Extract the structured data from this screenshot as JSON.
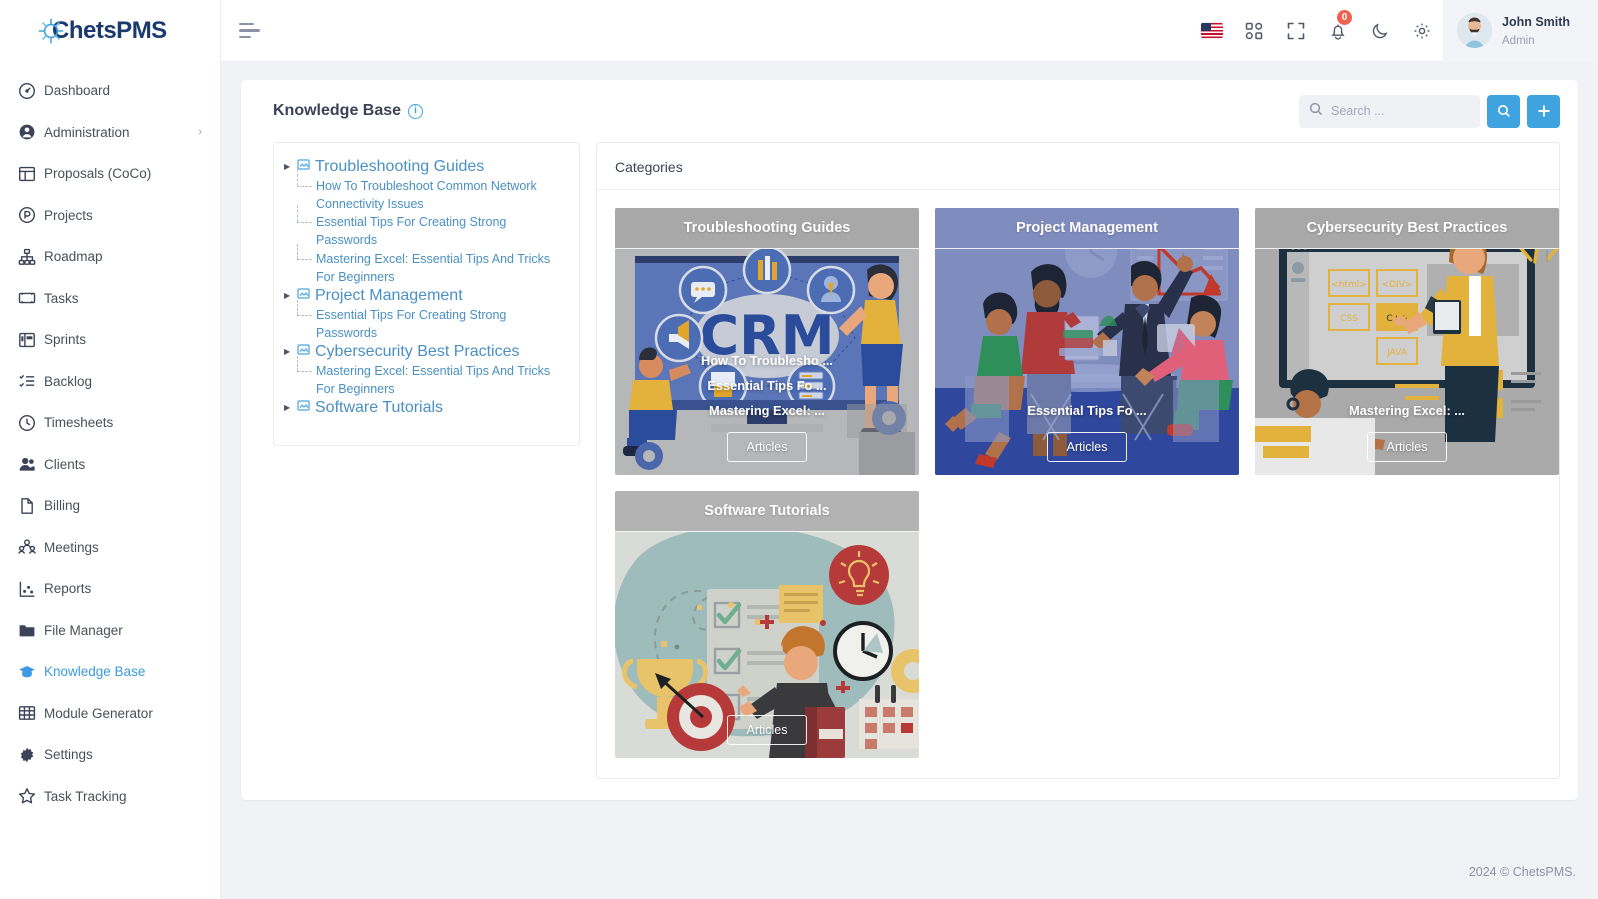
{
  "brand": {
    "name_prefix": "C",
    "name": "ChetsPMS"
  },
  "sidebar": {
    "items": [
      {
        "label": "Dashboard",
        "icon": "speedometer-icon",
        "active": false,
        "caret": ""
      },
      {
        "label": "Administration",
        "icon": "user-circle-icon",
        "active": false,
        "caret": "›"
      },
      {
        "label": "Proposals (CoCo)",
        "icon": "layout-icon",
        "active": false,
        "caret": ""
      },
      {
        "label": "Projects",
        "icon": "project-circle-icon",
        "active": false,
        "caret": ""
      },
      {
        "label": "Roadmap",
        "icon": "sitemap-icon",
        "active": false,
        "caret": ""
      },
      {
        "label": "Tasks",
        "icon": "ticket-icon",
        "active": false,
        "caret": ""
      },
      {
        "label": "Sprints",
        "icon": "board-icon",
        "active": false,
        "caret": ""
      },
      {
        "label": "Backlog",
        "icon": "checklist-icon",
        "active": false,
        "caret": ""
      },
      {
        "label": "Timesheets",
        "icon": "clock-icon",
        "active": false,
        "caret": ""
      },
      {
        "label": "Clients",
        "icon": "users-icon",
        "active": false,
        "caret": ""
      },
      {
        "label": "Billing",
        "icon": "file-icon",
        "active": false,
        "caret": ""
      },
      {
        "label": "Meetings",
        "icon": "people-group-icon",
        "active": false,
        "caret": ""
      },
      {
        "label": "Reports",
        "icon": "chart-scatter-icon",
        "active": false,
        "caret": ""
      },
      {
        "label": "File Manager",
        "icon": "folder-icon",
        "active": false,
        "caret": ""
      },
      {
        "label": "Knowledge Base",
        "icon": "graduation-cap-icon",
        "active": true,
        "caret": ""
      },
      {
        "label": "Module Generator",
        "icon": "grid-table-icon",
        "active": false,
        "caret": ""
      },
      {
        "label": "Settings",
        "icon": "gear-icon",
        "active": false,
        "caret": ""
      },
      {
        "label": "Task Tracking",
        "icon": "star-icon",
        "active": false,
        "caret": ""
      }
    ]
  },
  "topbar": {
    "menu_toggle": "hamburger-icon",
    "icons": [
      {
        "name": "language-flag-us",
        "glyph": ""
      },
      {
        "name": "apps-grid-icon",
        "glyph": ""
      },
      {
        "name": "fullscreen-icon",
        "glyph": ""
      },
      {
        "name": "notifications-bell-icon",
        "glyph": ""
      },
      {
        "name": "dark-mode-moon-icon",
        "glyph": ""
      },
      {
        "name": "settings-gear-icon",
        "glyph": ""
      }
    ],
    "notification_count": "0",
    "user": {
      "name": "John Smith",
      "role": "Admin"
    }
  },
  "page": {
    "title": "Knowledge Base",
    "info_glyph": "i",
    "search": {
      "placeholder": "Search ...",
      "value": ""
    },
    "search_button": "search-icon",
    "add_button": "+"
  },
  "tree": {
    "nodes": [
      {
        "label": "Troubleshooting Guides",
        "children": [
          "How To Troubleshoot Common Network Connectivity Issues",
          "Essential Tips For Creating Strong Passwords",
          "Mastering Excel: Essential Tips And Tricks For Beginners"
        ]
      },
      {
        "label": "Project Management",
        "children": [
          "Essential Tips For Creating Strong Passwords"
        ]
      },
      {
        "label": "Cybersecurity Best Practices",
        "children": [
          "Mastering Excel: Essential Tips And Tricks For Beginners"
        ]
      },
      {
        "label": "Software Tutorials",
        "children": []
      }
    ]
  },
  "categories": {
    "heading": "Categories",
    "articles_button": "Articles",
    "cards": [
      {
        "title": "Troubleshooting Guides",
        "header_bg": "#a8a8a8",
        "links": [
          "How To Troublesho ...",
          "Essential Tips Fo ...",
          "Mastering Excel: ..."
        ]
      },
      {
        "title": "Project Management",
        "header_bg": "#7f8cbe",
        "links": [
          "Essential Tips Fo ..."
        ]
      },
      {
        "title": "Cybersecurity Best Practices",
        "header_bg": "#a8a8a8",
        "links": [
          "Mastering Excel: ..."
        ]
      },
      {
        "title": "Software Tutorials",
        "header_bg": "#b3b3b3",
        "links": []
      }
    ]
  },
  "footer": {
    "copyright": "2024 © ChetsPMS."
  },
  "colors": {
    "accent": "#3fa3e0",
    "link": "#4a90c4",
    "sidebar_text": "#495057",
    "badge": "#f1614d"
  }
}
